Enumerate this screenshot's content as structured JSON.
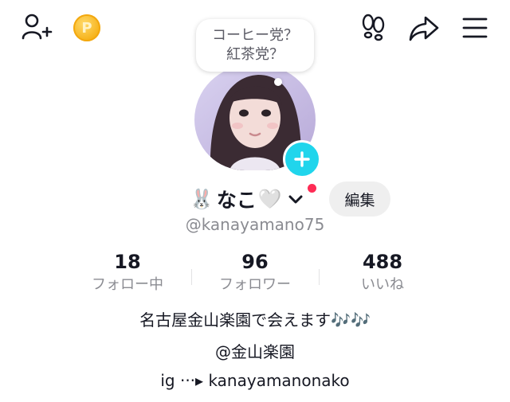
{
  "top_bar": {
    "icons": [
      "add-friend-icon",
      "coin-icon",
      "footprints-icon",
      "share-icon",
      "menu-icon"
    ],
    "coin_glyph": "P"
  },
  "thought_bubble": {
    "line1": "コーヒー党？",
    "line2": "紅茶党？"
  },
  "profile": {
    "emoji_prefix": "🐰",
    "name": "なこ",
    "emoji_suffix": "🤍",
    "username": "@kanayamano75",
    "edit_label": "編集"
  },
  "stats": [
    {
      "value": "18",
      "label": "フォロー中"
    },
    {
      "value": "96",
      "label": "フォロワー"
    },
    {
      "value": "488",
      "label": "いいね"
    }
  ],
  "bio": {
    "line1": "名古屋金山楽園で会えます🎶🎶",
    "line2": "@金山楽園",
    "line3": "ig ···▸ kanayamanonako"
  },
  "colors": {
    "accent_cyan": "#20d5ec",
    "notify_red": "#fe2c55",
    "coin_gold": "#f6b21a"
  }
}
